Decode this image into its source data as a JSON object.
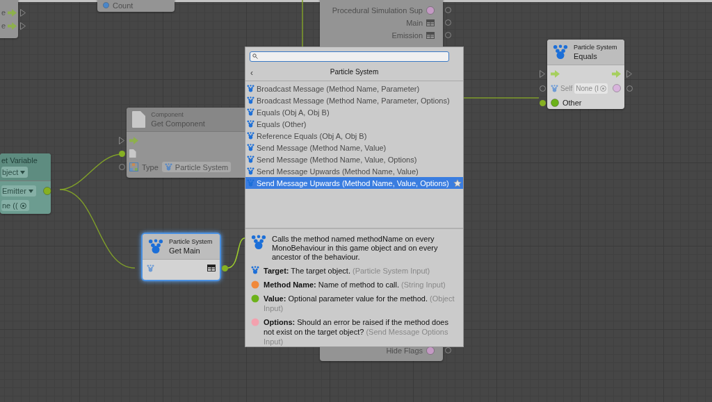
{
  "graph": {
    "nodes": [
      {
        "kind": "ports",
        "dimmed": true,
        "selected": false,
        "rows": [
          "e",
          "e"
        ]
      },
      {
        "kind": "count",
        "dimmed": true,
        "selected": false,
        "label": "Count"
      },
      {
        "kind": "outputs",
        "dimmed": true,
        "selected": false,
        "rows": [
          {
            "label": "Procedural Simulation Sup",
            "kind": "dot"
          },
          {
            "label": "Main",
            "kind": "struct"
          },
          {
            "label": "Emission",
            "kind": "struct"
          }
        ],
        "footer": {
          "label": "Hide Flags",
          "kind": "dot"
        }
      },
      {
        "kind": "component",
        "dimmed": true,
        "selected": false,
        "category": "Component",
        "title": "Get Component",
        "type_label": "Type",
        "type_value": "Particle System"
      },
      {
        "kind": "variable",
        "dimmed": true,
        "selected": false,
        "title": "et Variable",
        "scope": "bject",
        "name": "Emitter",
        "value": "ne (("
      },
      {
        "kind": "getter",
        "dimmed": false,
        "selected": true,
        "category": "Particle System",
        "title": "Get Main"
      },
      {
        "kind": "equals",
        "dimmed": false,
        "selected": false,
        "category": "Particle System",
        "title": "Equals",
        "self_label": "Self",
        "self_value": "None (I",
        "other_label": "Other"
      }
    ]
  },
  "popup": {
    "back": "‹",
    "title": "Particle System",
    "items": [
      {
        "label": "Broadcast Message (Method Name, Parameter)",
        "selected": false
      },
      {
        "label": "Broadcast Message (Method Name, Parameter, Options)",
        "selected": false
      },
      {
        "label": "Equals (Obj A, Obj B)",
        "selected": false
      },
      {
        "label": "Equals (Other)",
        "selected": false
      },
      {
        "label": "Reference Equals (Obj A, Obj B)",
        "selected": false
      },
      {
        "label": "Send Message (Method Name, Value)",
        "selected": false
      },
      {
        "label": "Send Message (Method Name, Value, Options)",
        "selected": false
      },
      {
        "label": "Send Message Upwards (Method Name, Value)",
        "selected": false
      },
      {
        "label": "Send Message Upwards (Method Name, Value, Options)",
        "selected": true
      }
    ],
    "description": {
      "summary": "Calls the method named methodName on every MonoBehaviour in this game object and on every ancestor of the behaviour.",
      "ports": [
        {
          "kind": "target",
          "name": "Target:",
          "text": "The target object.",
          "type": "(Particle System Input)"
        },
        {
          "kind": "dot",
          "color": "#f0893a",
          "name": "Method Name:",
          "text": "Name of method to call.",
          "type": "(String Input)"
        },
        {
          "kind": "dot",
          "color": "#6cb21a",
          "name": "Value:",
          "text": "Optional parameter value for the method.",
          "type": "(Object Input)"
        },
        {
          "kind": "dot",
          "color": "#f3a1ae",
          "name": "Options:",
          "text": "Should an error be raised if the method does not exist on the target object?",
          "type": "(Send Message Options Input)"
        }
      ]
    }
  }
}
